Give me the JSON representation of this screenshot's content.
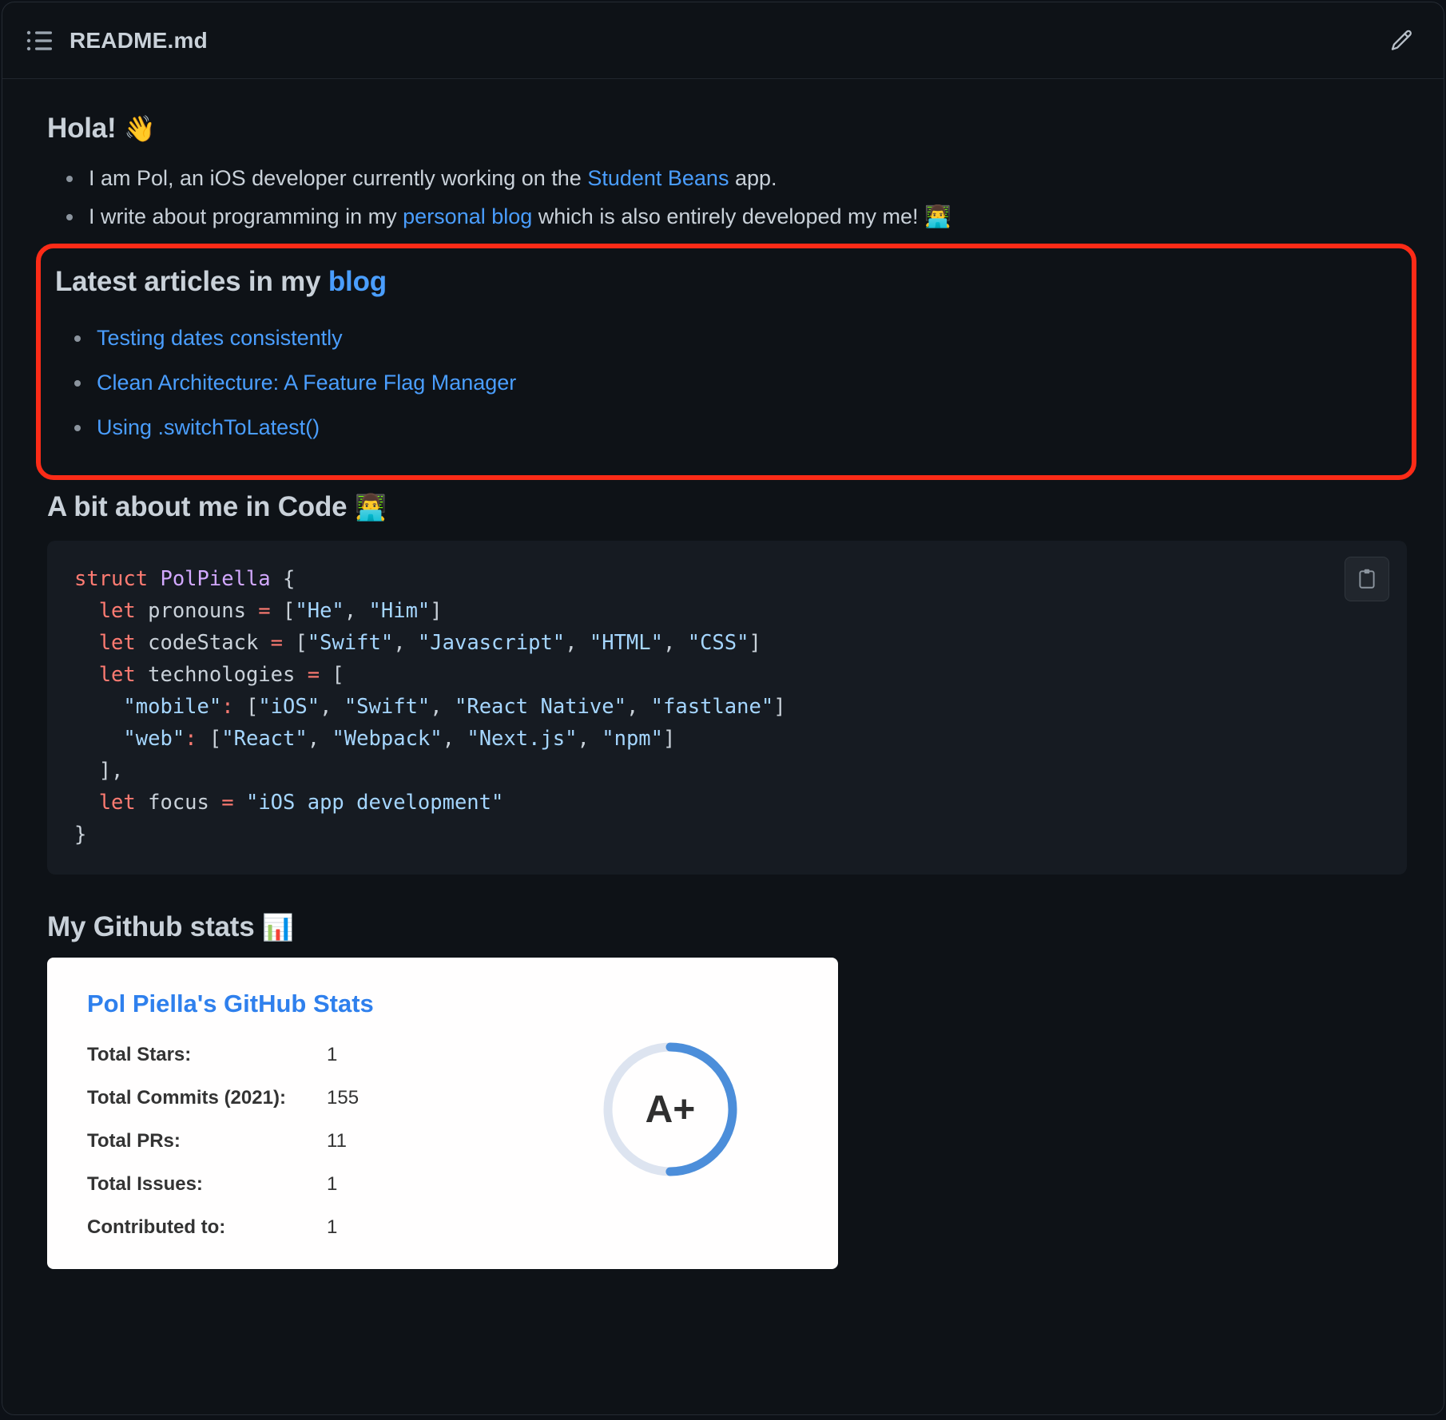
{
  "header": {
    "file_name": "README.md",
    "list_icon": "list-icon",
    "edit_icon": "pencil-icon"
  },
  "readme": {
    "greeting_heading": "Hola! ",
    "greeting_emoji": "👋",
    "intro_bullets": [
      {
        "before": "I am Pol, an iOS developer currently working on the ",
        "link": "Student Beans",
        "after": " app.",
        "emoji": ""
      },
      {
        "before": "I write about programming in my ",
        "link": "personal blog",
        "after": " which is also entirely developed my me! ",
        "emoji": "👨‍💻"
      }
    ],
    "latest_articles": {
      "heading_text": "Latest articles in my ",
      "heading_link": "blog",
      "highlight_color": "#fc2b17",
      "items": [
        "Testing dates consistently",
        "Clean Architecture: A Feature Flag Manager",
        "Using .switchToLatest()"
      ]
    },
    "code_section": {
      "heading_text": "A bit about me in Code ",
      "heading_emoji": "👨‍💻",
      "copy_button_icon": "clipboard-icon",
      "lines": [
        [
          {
            "t": "struct ",
            "c": "kw"
          },
          {
            "t": "PolPiella",
            "c": "type"
          },
          {
            "t": " {",
            "c": "plain"
          }
        ],
        [
          {
            "t": "  let ",
            "c": "kw"
          },
          {
            "t": "pronouns ",
            "c": "plain"
          },
          {
            "t": "=",
            "c": "op"
          },
          {
            "t": " [",
            "c": "plain"
          },
          {
            "t": "\"He\"",
            "c": "str"
          },
          {
            "t": ", ",
            "c": "plain"
          },
          {
            "t": "\"Him\"",
            "c": "str"
          },
          {
            "t": "]",
            "c": "plain"
          }
        ],
        [
          {
            "t": "  let ",
            "c": "kw"
          },
          {
            "t": "codeStack ",
            "c": "plain"
          },
          {
            "t": "=",
            "c": "op"
          },
          {
            "t": " [",
            "c": "plain"
          },
          {
            "t": "\"Swift\"",
            "c": "str"
          },
          {
            "t": ", ",
            "c": "plain"
          },
          {
            "t": "\"Javascript\"",
            "c": "str"
          },
          {
            "t": ", ",
            "c": "plain"
          },
          {
            "t": "\"HTML\"",
            "c": "str"
          },
          {
            "t": ", ",
            "c": "plain"
          },
          {
            "t": "\"CSS\"",
            "c": "str"
          },
          {
            "t": "]",
            "c": "plain"
          }
        ],
        [
          {
            "t": "  let ",
            "c": "kw"
          },
          {
            "t": "technologies ",
            "c": "plain"
          },
          {
            "t": "=",
            "c": "op"
          },
          {
            "t": " [",
            "c": "plain"
          }
        ],
        [
          {
            "t": "    ",
            "c": "plain"
          },
          {
            "t": "\"mobile\"",
            "c": "str"
          },
          {
            "t": ":",
            "c": "op"
          },
          {
            "t": " [",
            "c": "plain"
          },
          {
            "t": "\"iOS\"",
            "c": "str"
          },
          {
            "t": ", ",
            "c": "plain"
          },
          {
            "t": "\"Swift\"",
            "c": "str"
          },
          {
            "t": ", ",
            "c": "plain"
          },
          {
            "t": "\"React Native\"",
            "c": "str"
          },
          {
            "t": ", ",
            "c": "plain"
          },
          {
            "t": "\"fastlane\"",
            "c": "str"
          },
          {
            "t": "]",
            "c": "plain"
          }
        ],
        [
          {
            "t": "    ",
            "c": "plain"
          },
          {
            "t": "\"web\"",
            "c": "str"
          },
          {
            "t": ":",
            "c": "op"
          },
          {
            "t": " [",
            "c": "plain"
          },
          {
            "t": "\"React\"",
            "c": "str"
          },
          {
            "t": ", ",
            "c": "plain"
          },
          {
            "t": "\"Webpack\"",
            "c": "str"
          },
          {
            "t": ", ",
            "c": "plain"
          },
          {
            "t": "\"Next.js\"",
            "c": "str"
          },
          {
            "t": ", ",
            "c": "plain"
          },
          {
            "t": "\"npm\"",
            "c": "str"
          },
          {
            "t": "]",
            "c": "plain"
          }
        ],
        [
          {
            "t": "  ],",
            "c": "plain"
          }
        ],
        [
          {
            "t": "  let ",
            "c": "kw"
          },
          {
            "t": "focus ",
            "c": "plain"
          },
          {
            "t": "=",
            "c": "op"
          },
          {
            "t": " ",
            "c": "plain"
          },
          {
            "t": "\"iOS app development\"",
            "c": "str"
          }
        ],
        [
          {
            "t": "}",
            "c": "plain"
          }
        ]
      ]
    },
    "stats_section": {
      "heading_text": "My Github stats ",
      "heading_emoji": "📊",
      "card": {
        "title": "Pol Piella's GitHub Stats",
        "rows": [
          {
            "label": "Total Stars:",
            "value": "1"
          },
          {
            "label": "Total Commits (2021):",
            "value": "155"
          },
          {
            "label": "Total PRs:",
            "value": "11"
          },
          {
            "label": "Total Issues:",
            "value": "1"
          },
          {
            "label": "Contributed to:",
            "value": "1"
          }
        ],
        "rank": "A+",
        "rank_progress_percent": 50,
        "rank_color": "#4c8eda",
        "rank_track_color": "#dde4f0",
        "title_color": "#2f80ed"
      }
    }
  }
}
